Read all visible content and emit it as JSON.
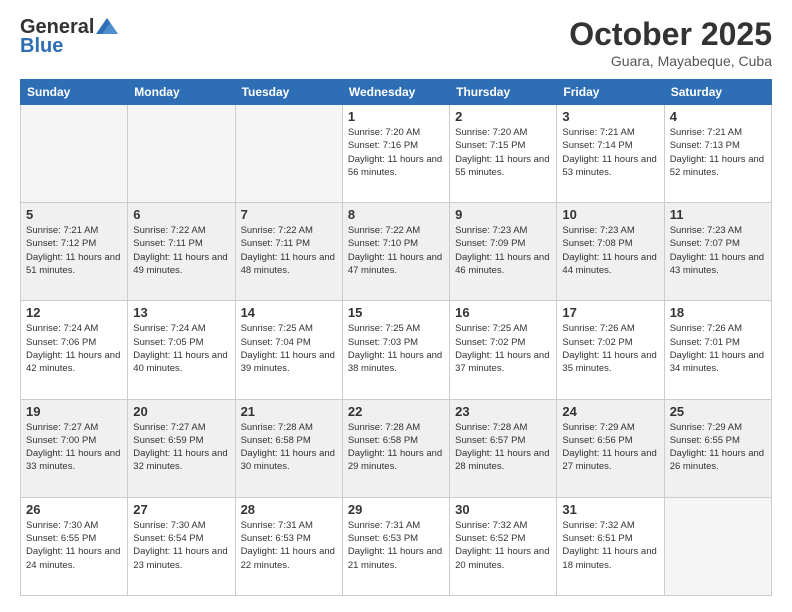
{
  "header": {
    "logo_general": "General",
    "logo_blue": "Blue",
    "month_title": "October 2025",
    "subtitle": "Guara, Mayabeque, Cuba"
  },
  "weekdays": [
    "Sunday",
    "Monday",
    "Tuesday",
    "Wednesday",
    "Thursday",
    "Friday",
    "Saturday"
  ],
  "weeks": [
    [
      {
        "day": "",
        "empty": true
      },
      {
        "day": "",
        "empty": true
      },
      {
        "day": "",
        "empty": true
      },
      {
        "day": "1",
        "sunrise": "7:20 AM",
        "sunset": "7:16 PM",
        "daylight": "11 hours and 56 minutes."
      },
      {
        "day": "2",
        "sunrise": "7:20 AM",
        "sunset": "7:15 PM",
        "daylight": "11 hours and 55 minutes."
      },
      {
        "day": "3",
        "sunrise": "7:21 AM",
        "sunset": "7:14 PM",
        "daylight": "11 hours and 53 minutes."
      },
      {
        "day": "4",
        "sunrise": "7:21 AM",
        "sunset": "7:13 PM",
        "daylight": "11 hours and 52 minutes."
      }
    ],
    [
      {
        "day": "5",
        "sunrise": "7:21 AM",
        "sunset": "7:12 PM",
        "daylight": "11 hours and 51 minutes."
      },
      {
        "day": "6",
        "sunrise": "7:22 AM",
        "sunset": "7:11 PM",
        "daylight": "11 hours and 49 minutes."
      },
      {
        "day": "7",
        "sunrise": "7:22 AM",
        "sunset": "7:11 PM",
        "daylight": "11 hours and 48 minutes."
      },
      {
        "day": "8",
        "sunrise": "7:22 AM",
        "sunset": "7:10 PM",
        "daylight": "11 hours and 47 minutes."
      },
      {
        "day": "9",
        "sunrise": "7:23 AM",
        "sunset": "7:09 PM",
        "daylight": "11 hours and 46 minutes."
      },
      {
        "day": "10",
        "sunrise": "7:23 AM",
        "sunset": "7:08 PM",
        "daylight": "11 hours and 44 minutes."
      },
      {
        "day": "11",
        "sunrise": "7:23 AM",
        "sunset": "7:07 PM",
        "daylight": "11 hours and 43 minutes."
      }
    ],
    [
      {
        "day": "12",
        "sunrise": "7:24 AM",
        "sunset": "7:06 PM",
        "daylight": "11 hours and 42 minutes."
      },
      {
        "day": "13",
        "sunrise": "7:24 AM",
        "sunset": "7:05 PM",
        "daylight": "11 hours and 40 minutes."
      },
      {
        "day": "14",
        "sunrise": "7:25 AM",
        "sunset": "7:04 PM",
        "daylight": "11 hours and 39 minutes."
      },
      {
        "day": "15",
        "sunrise": "7:25 AM",
        "sunset": "7:03 PM",
        "daylight": "11 hours and 38 minutes."
      },
      {
        "day": "16",
        "sunrise": "7:25 AM",
        "sunset": "7:02 PM",
        "daylight": "11 hours and 37 minutes."
      },
      {
        "day": "17",
        "sunrise": "7:26 AM",
        "sunset": "7:02 PM",
        "daylight": "11 hours and 35 minutes."
      },
      {
        "day": "18",
        "sunrise": "7:26 AM",
        "sunset": "7:01 PM",
        "daylight": "11 hours and 34 minutes."
      }
    ],
    [
      {
        "day": "19",
        "sunrise": "7:27 AM",
        "sunset": "7:00 PM",
        "daylight": "11 hours and 33 minutes."
      },
      {
        "day": "20",
        "sunrise": "7:27 AM",
        "sunset": "6:59 PM",
        "daylight": "11 hours and 32 minutes."
      },
      {
        "day": "21",
        "sunrise": "7:28 AM",
        "sunset": "6:58 PM",
        "daylight": "11 hours and 30 minutes."
      },
      {
        "day": "22",
        "sunrise": "7:28 AM",
        "sunset": "6:58 PM",
        "daylight": "11 hours and 29 minutes."
      },
      {
        "day": "23",
        "sunrise": "7:28 AM",
        "sunset": "6:57 PM",
        "daylight": "11 hours and 28 minutes."
      },
      {
        "day": "24",
        "sunrise": "7:29 AM",
        "sunset": "6:56 PM",
        "daylight": "11 hours and 27 minutes."
      },
      {
        "day": "25",
        "sunrise": "7:29 AM",
        "sunset": "6:55 PM",
        "daylight": "11 hours and 26 minutes."
      }
    ],
    [
      {
        "day": "26",
        "sunrise": "7:30 AM",
        "sunset": "6:55 PM",
        "daylight": "11 hours and 24 minutes."
      },
      {
        "day": "27",
        "sunrise": "7:30 AM",
        "sunset": "6:54 PM",
        "daylight": "11 hours and 23 minutes."
      },
      {
        "day": "28",
        "sunrise": "7:31 AM",
        "sunset": "6:53 PM",
        "daylight": "11 hours and 22 minutes."
      },
      {
        "day": "29",
        "sunrise": "7:31 AM",
        "sunset": "6:53 PM",
        "daylight": "11 hours and 21 minutes."
      },
      {
        "day": "30",
        "sunrise": "7:32 AM",
        "sunset": "6:52 PM",
        "daylight": "11 hours and 20 minutes."
      },
      {
        "day": "31",
        "sunrise": "7:32 AM",
        "sunset": "6:51 PM",
        "daylight": "11 hours and 18 minutes."
      },
      {
        "day": "",
        "empty": true
      }
    ]
  ]
}
